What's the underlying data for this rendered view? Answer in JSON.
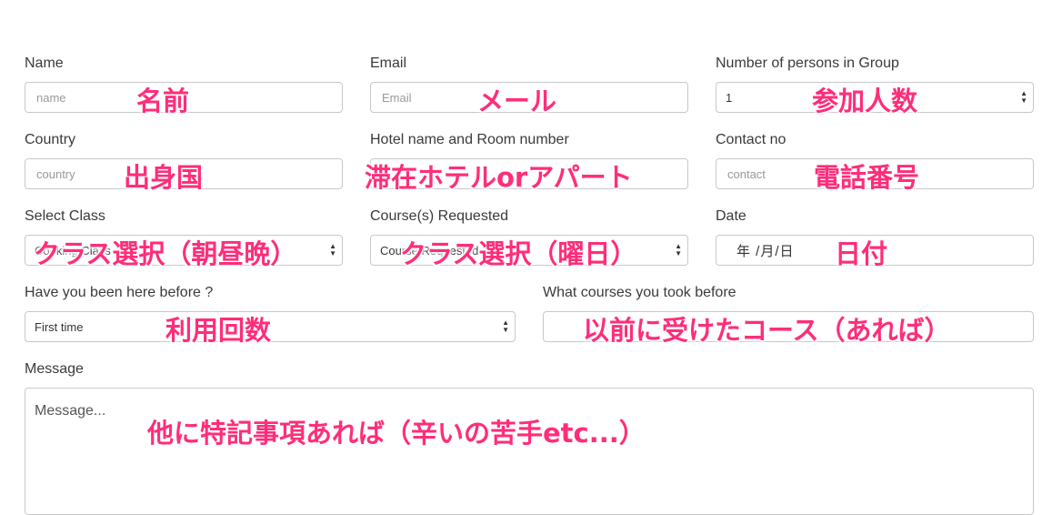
{
  "form": {
    "name": {
      "label": "Name",
      "placeholder": "name"
    },
    "email": {
      "label": "Email",
      "placeholder": "Email"
    },
    "persons": {
      "label": "Number of persons in Group",
      "value": "1"
    },
    "country": {
      "label": "Country",
      "placeholder": "country"
    },
    "hotel": {
      "label": "Hotel name and Room number",
      "placeholder": ""
    },
    "contact": {
      "label": "Contact no",
      "placeholder": "contact"
    },
    "select_class": {
      "label": "Select Class",
      "value": "Cooking Class"
    },
    "courses": {
      "label": "Course(s) Requested",
      "value": "Course Requested"
    },
    "date": {
      "label": "Date",
      "value": "年 /月/日"
    },
    "been_here": {
      "label": "Have you been here before ?",
      "value": "First time"
    },
    "courses_before": {
      "label": "What courses you took before",
      "placeholder": ""
    },
    "message": {
      "label": "Message",
      "placeholder": "Message..."
    }
  },
  "annotations": {
    "name": "名前",
    "email": "メール",
    "persons": "参加人数",
    "country": "出身国",
    "hotel": "滞在ホテルorアパート",
    "contact": "電話番号",
    "select_class": "クラス選択（朝昼晩）",
    "courses": "クラス選択（曜日）",
    "date": "日付",
    "been_here": "利用回数",
    "courses_before": "以前に受けたコース（あれば）",
    "message": "他に特記事項あれば（辛いの苦手etc...）"
  },
  "colors": {
    "annotation": "#ff2d7a",
    "border": "#c8c8c8",
    "label": "#3a3a3a"
  },
  "icons": {
    "select_arrows": "up-down-arrows-icon"
  }
}
